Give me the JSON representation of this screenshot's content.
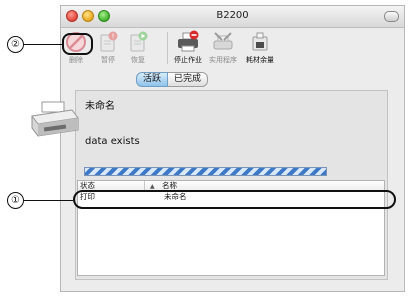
{
  "window": {
    "title": "B2200"
  },
  "toolbar": {
    "delete_label": "删除",
    "pause_label": "暂停",
    "resume_label": "恢复",
    "stop_job_label": "停止作业",
    "utility_label": "实用程序",
    "supplies_label": "耗材余量"
  },
  "tabs": {
    "active_label": "活跃",
    "completed_label": "已完成"
  },
  "job": {
    "name": "未命名",
    "status": "data exists"
  },
  "table": {
    "columns": [
      "状态",
      "名称"
    ],
    "rows": [
      {
        "status": "打印",
        "name": "未命名"
      }
    ]
  },
  "callouts": {
    "one": "①",
    "two": "②"
  },
  "colors": {
    "accent": "#3d79c6",
    "active_tab": "#8fc3ea"
  }
}
